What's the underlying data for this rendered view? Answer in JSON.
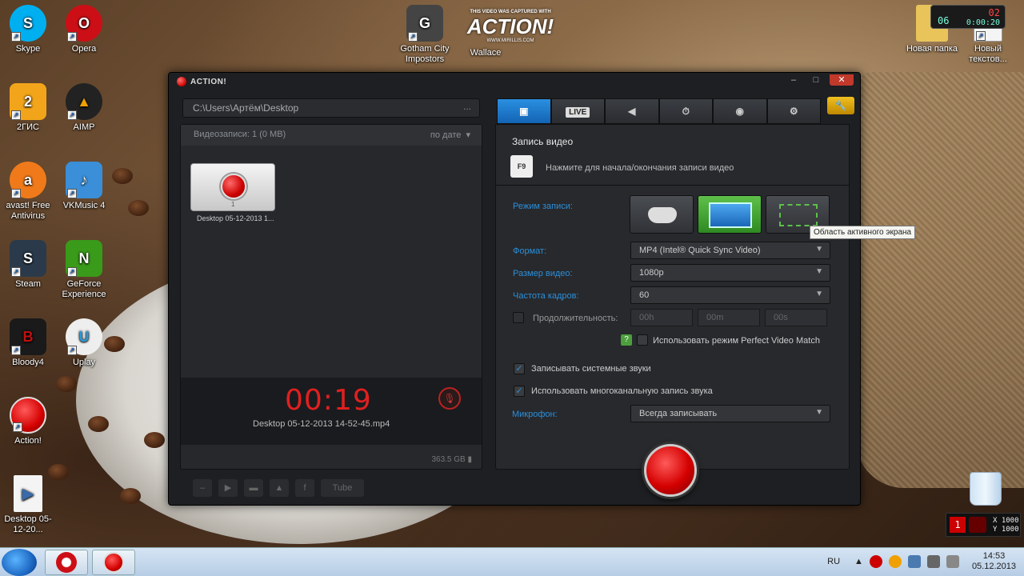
{
  "desktop": {
    "icons": [
      {
        "label": "Skype",
        "symbol": "S",
        "color": "#00aff0"
      },
      {
        "label": "Opera",
        "symbol": "O",
        "color": "#cc0f16"
      },
      {
        "label": "2ГИС",
        "symbol": "2",
        "color": "#f2a51a"
      },
      {
        "label": "AIMP",
        "symbol": "▲",
        "color": "#f0a000"
      },
      {
        "label": "avast! Free Antivirus",
        "symbol": "a",
        "color": "#f07a1a"
      },
      {
        "label": "VKMusic 4",
        "symbol": "♪",
        "color": "#3a8fd8"
      },
      {
        "label": "Steam",
        "symbol": "S",
        "color": "#2a3a4a"
      },
      {
        "label": "GeForce Experience",
        "symbol": "N",
        "color": "#3a9a1a"
      },
      {
        "label": "Bloody4",
        "symbol": "B",
        "color": "#a01010"
      },
      {
        "label": "Uplay",
        "symbol": "U",
        "color": "#2a9ad8"
      },
      {
        "label": "Action!",
        "symbol": "",
        "color": "#d40000"
      },
      {
        "label": "Desktop 05-12-20...",
        "symbol": "▶",
        "color": "#3a6aa8"
      },
      {
        "label": "Gotham City Impostors",
        "symbol": "G",
        "color": "#444"
      },
      {
        "label": "Wallace",
        "symbol": "A",
        "color": "#222"
      },
      {
        "label": "Новая папка",
        "symbol": "",
        "color": "#e8c45a"
      },
      {
        "label": "Новый текстов...",
        "symbol": "",
        "color": "#f4f4f4"
      }
    ],
    "watermark": "ACTION!",
    "watermark_sub": "THIS VIDEO WAS CAPTURED WITH",
    "watermark_url": "WWW.MIRILLIS.COM",
    "widget_top": "06",
    "widget_badge": "02",
    "widget_time": "0:00:20",
    "coords": {
      "badge": "1",
      "x": "X 1000",
      "y": "Y 1000"
    }
  },
  "window": {
    "title": "ACTION!",
    "controls": {
      "min": "–",
      "max": "□",
      "close": "✕"
    },
    "path": "C:\\Users\\Артём\\Desktop",
    "path_more": "...",
    "list_header": "Видеозаписи: 1 (0 MB)",
    "sort_label": "по дате",
    "thumb_label": "Desktop 05-12-2013 1...",
    "thumb_num": "1",
    "timer": "00:19",
    "current_file": "Desktop 05-12-2013 14-52-45.mp4",
    "disk_free": "363.5 GB",
    "bottom_share_label": "Tube",
    "tabs": [
      {
        "name": "video",
        "symbol": "▣"
      },
      {
        "name": "live",
        "symbol": "LIVE"
      },
      {
        "name": "audio",
        "symbol": "◀"
      },
      {
        "name": "benchmark",
        "symbol": "⏱"
      },
      {
        "name": "screenshot",
        "symbol": "◉"
      },
      {
        "name": "settings",
        "symbol": "⚙"
      }
    ],
    "extra_btn": "🔧",
    "section_title": "Запись видео",
    "hotkey": "F9",
    "hotkey_desc": "Нажмите для начала/окончания записи видео",
    "labels": {
      "mode": "Режим записи:",
      "format": "Формат:",
      "size": "Размер видео:",
      "fps": "Частота кадров:",
      "duration": "Продолжительность:",
      "pvm": "Использовать режим Perfect Video Match",
      "system_sounds": "Записывать системные звуки",
      "multichannel": "Использовать многоканальную запись звука",
      "mic": "Микрофон:"
    },
    "values": {
      "format": "MP4 (Intel® Quick Sync Video)",
      "size": "1080p",
      "fps": "60",
      "hours": "00h",
      "minutes": "00m",
      "seconds": "00s",
      "mic": "Всегда записывать"
    },
    "checks": {
      "system_sounds": "✓",
      "multichannel": "✓",
      "help": "?"
    },
    "tooltip": "Область активного экрана"
  },
  "taskbar": {
    "lang": "RU",
    "time": "14:53",
    "date": "05.12.2013"
  },
  "colors": {
    "accent": "#2c8fd8",
    "record": "#d40000",
    "timer": "#e02020"
  }
}
